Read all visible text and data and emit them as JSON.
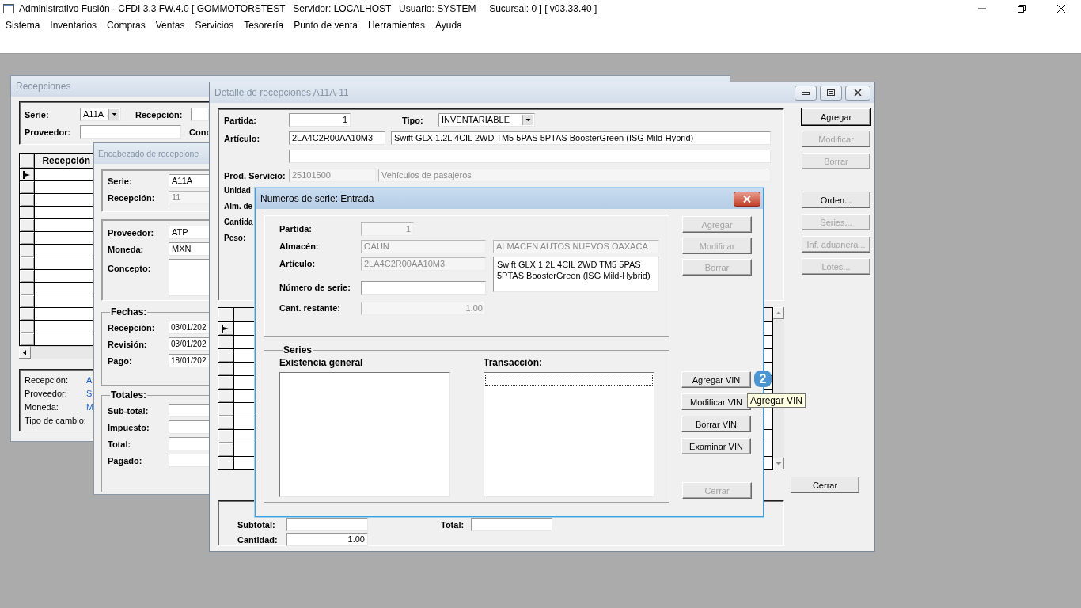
{
  "app_title": "Administrativo Fusión - CFDI 3.3 FW.4.0 [ GOMMOTORSTEST   Servidor: LOCALHOST   Usuario: SYSTEM     Sucursal: 0 ] [ v03.33.40 ]",
  "menu": [
    "Sistema",
    "Inventarios",
    "Compras",
    "Ventas",
    "Servicios",
    "Tesorería",
    "Punto de venta",
    "Herramientas",
    "Ayuda"
  ],
  "recepciones": {
    "title": "Recepciones",
    "serie": {
      "label": "Serie:",
      "value": "A11A"
    },
    "recepcion_label": "Recepción:",
    "proveedor_label": "Proveedor:",
    "concepto_label": "Conc",
    "grid": {
      "column": "Recepción",
      "rows": [
        {
          "current": true
        },
        {
          "current": false
        },
        {
          "current": false
        },
        {
          "current": false
        },
        {
          "current": false
        },
        {
          "current": false
        },
        {
          "current": false
        },
        {
          "current": false
        },
        {
          "current": false
        },
        {
          "current": false
        },
        {
          "current": false
        },
        {
          "current": false
        },
        {
          "current": false
        },
        {
          "current": false
        }
      ]
    },
    "summary": [
      {
        "label": "Recepción:",
        "value": "A"
      },
      {
        "label": "Proveedor:",
        "value": "S"
      },
      {
        "label": "Moneda:",
        "value": "M"
      },
      {
        "label": "Tipo de cambio:"
      }
    ]
  },
  "encabezado": {
    "title": "Encabezado de recepcione",
    "header_fields": [
      {
        "label": "Serie:",
        "value": "A11A",
        "disabled": false
      },
      {
        "label": "Recepción:",
        "value": "11",
        "disabled": true
      }
    ],
    "supplier_fields": [
      {
        "label": "Proveedor:",
        "value": "ATP"
      },
      {
        "label": "Moneda:",
        "value": "MXN"
      }
    ],
    "concepto_label": "Concepto:",
    "fechas": {
      "legend": "Fechas:",
      "fields": [
        {
          "label": "Recepción:",
          "value": "03/01/202"
        },
        {
          "label": "Revisión:",
          "value": "03/01/202"
        },
        {
          "label": "Pago:",
          "value": "18/01/202"
        }
      ]
    },
    "totales": {
      "legend": "Totales:",
      "fields": [
        {
          "label": "Sub-total:"
        },
        {
          "label": "Impuesto:"
        },
        {
          "label": "Total:"
        },
        {
          "label": "Pagado:"
        }
      ]
    }
  },
  "detalle": {
    "title": "Detalle de recepciones A11A-11",
    "partida": {
      "label": "Partida:",
      "value": "1"
    },
    "tipo": {
      "label": "Tipo:",
      "value": "INVENTARIABLE"
    },
    "articulo": {
      "label": "Artículo:",
      "code": "2LA4C2R00AA10M3",
      "description": "Swift GLX 1.2L 4CIL 2WD TM5 5PAS 5PTAS BoosterGreen (ISG Mild-Hybrid)"
    },
    "prod_servicio": {
      "label": "Prod. Servicio:",
      "code": "25101500",
      "description": "Vehículos de pasajeros",
      "disabled": true
    },
    "covered_labels": [
      "Unidad",
      "Alm. de",
      "Cantida",
      "Peso:"
    ],
    "buttons": [
      {
        "label": "Agregar",
        "disabled": false
      },
      {
        "label": "Modificar",
        "disabled": true
      },
      {
        "label": "Borrar",
        "disabled": true
      },
      {
        "label": "Orden...",
        "disabled": false
      },
      {
        "label": "Series...",
        "disabled": true
      },
      {
        "label": "Inf. aduanera...",
        "disabled": true
      },
      {
        "label": "Lotes...",
        "disabled": true
      }
    ],
    "grid_rows": [
      {
        "current": true
      },
      {
        "current": false
      },
      {
        "current": false
      },
      {
        "current": false
      },
      {
        "current": false
      },
      {
        "current": false
      },
      {
        "current": false
      },
      {
        "current": false
      },
      {
        "current": false
      },
      {
        "current": false
      },
      {
        "current": false
      }
    ],
    "close_button": "Cerrar",
    "totals": [
      {
        "label": "Subtotal:"
      },
      {
        "label": "Total:"
      }
    ],
    "cantidad": {
      "label": "Cantidad:",
      "value": "1.00"
    }
  },
  "serie_dialog": {
    "title": "Numeros de serie: Entrada",
    "fields": [
      {
        "label": "Partida:",
        "value": "1",
        "disabled": true
      },
      {
        "label": "Almacén:",
        "value": "OAUN",
        "disabled": true
      },
      {
        "label": "Artículo:",
        "value": "2LA4C2R00AA10M3",
        "disabled": true
      },
      {
        "label": "Número de serie:",
        "disabled": false
      },
      {
        "label": "Cant. restante:",
        "value": "1.00",
        "disabled": true
      }
    ],
    "almacen_name": "ALMACEN AUTOS NUEVOS OAXACA",
    "articulo_description": "Swift GLX 1.2L 4CIL 2WD TM5 5PAS 5PTAS BoosterGreen (ISG Mild-Hybrid)",
    "buttons": [
      {
        "label": "Agregar",
        "disabled": true
      },
      {
        "label": "Modificar",
        "disabled": true
      },
      {
        "label": "Borrar",
        "disabled": true
      }
    ],
    "series": {
      "legend": "Series",
      "existencia_label": "Existencia general",
      "transaccion_label": "Transacción:"
    },
    "vin_buttons": [
      {
        "label": "Agregar VIN",
        "disabled": false
      },
      {
        "label": "Modificar VIN",
        "disabled": false
      },
      {
        "label": "Borrar VIN",
        "disabled": false
      },
      {
        "label": "Examinar VIN",
        "disabled": false
      }
    ],
    "close_button": {
      "label": "Cerrar",
      "disabled": true
    }
  },
  "step_badge": "2",
  "tooltip": "Agregar VIN"
}
